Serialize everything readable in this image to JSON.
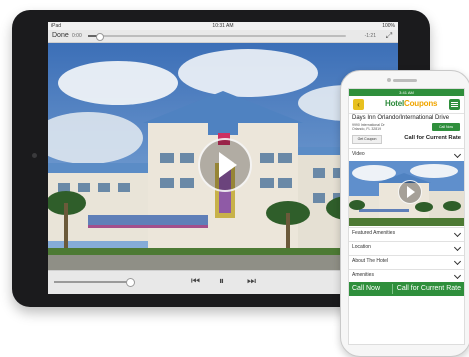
{
  "tablet": {
    "status": {
      "carrier": "iPad",
      "time": "10:31 AM",
      "battery": "100%"
    },
    "controls": {
      "done_label": "Done",
      "elapsed": "0:00",
      "remaining": "-1:21"
    }
  },
  "phone": {
    "status": {
      "carrier": "",
      "time": "3:41 AM",
      "battery": ""
    },
    "logo": {
      "part1": "Hotel",
      "part2": "Coupons"
    },
    "hotel_name": "Days Inn Orlando/International Drive",
    "address_line1": "9990 International Dr",
    "address_line2": "Orlando, FL 32819",
    "call_now_small": "Call Now",
    "get_coupon": "Get Coupon",
    "call_rate": "Call for Current Rate",
    "sections": [
      "Video",
      "Featured Amenities",
      "Location",
      "About The Hotel",
      "Amenities"
    ],
    "bottom_left": "Call Now",
    "bottom_right": "Call for Current Rate"
  },
  "colors": {
    "brand_green": "#2f8f3c",
    "brand_yellow": "#e8c11f"
  },
  "icons": {
    "tablet": [
      "play-icon",
      "rewind-icon",
      "pause-icon",
      "fast-forward-icon",
      "fullscreen-icon"
    ],
    "phone": [
      "back-icon",
      "menu-icon",
      "chevron-down-icon",
      "play-icon"
    ]
  }
}
